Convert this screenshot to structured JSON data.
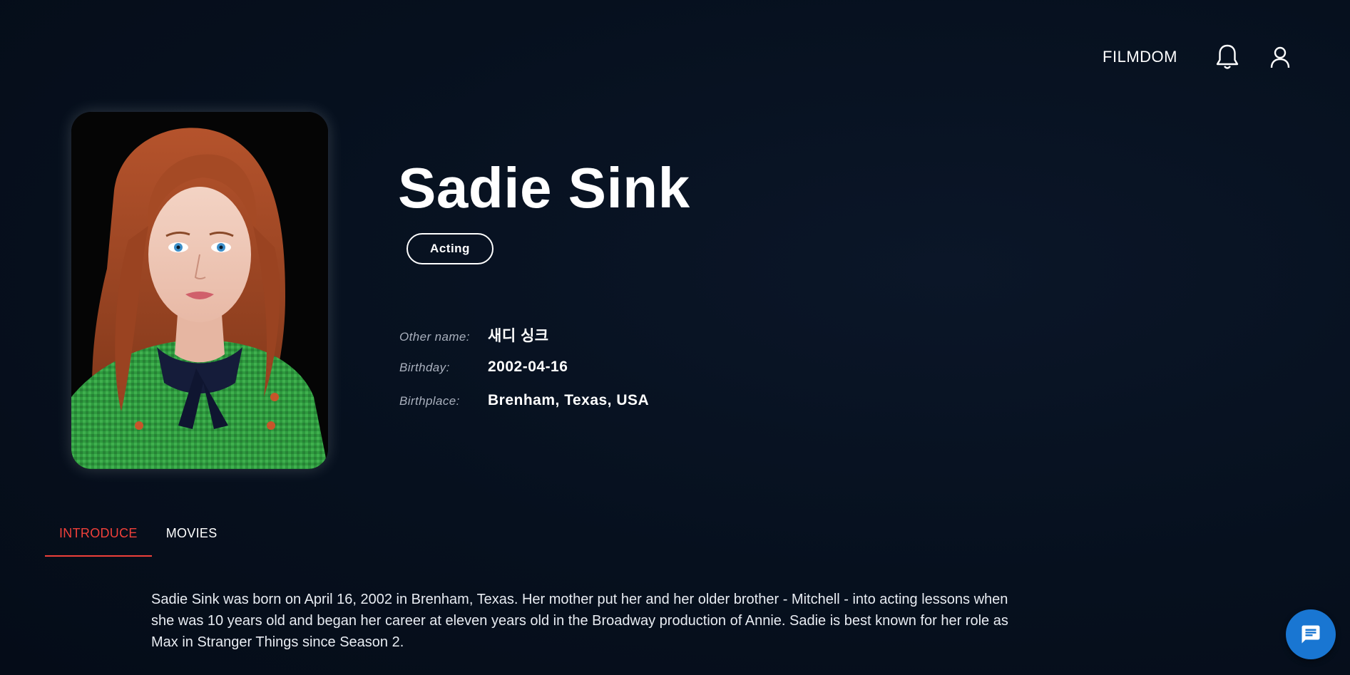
{
  "header": {
    "brand": "FILMDOM",
    "notification_icon": "bell-icon",
    "account_icon": "user-icon"
  },
  "person": {
    "name": "Sadie Sink",
    "department": "Acting",
    "photo_icon": "profile-photo",
    "details": [
      {
        "label": "Other name:",
        "value": "새디 싱크"
      },
      {
        "label": "Birthday:",
        "value": "2002-04-16"
      },
      {
        "label": "Birthplace:",
        "value": "Brenham, Texas, USA"
      }
    ]
  },
  "tabs": [
    {
      "label": "INTRODUCE",
      "active": true
    },
    {
      "label": "MOVIES",
      "active": false
    }
  ],
  "bio": "Sadie Sink was born on April 16, 2002 in Brenham, Texas. Her mother put her and her older brother - Mitchell - into acting lessons when she was 10 years old and began her career at eleven years old in the Broadway production of Annie. Sadie is best known for her role as Max in Stranger Things since Season 2.",
  "chat": {
    "icon": "chat-icon"
  },
  "colors": {
    "background": "#06101e",
    "active_tab": "#f0403a",
    "chat_button": "#1976d2"
  }
}
